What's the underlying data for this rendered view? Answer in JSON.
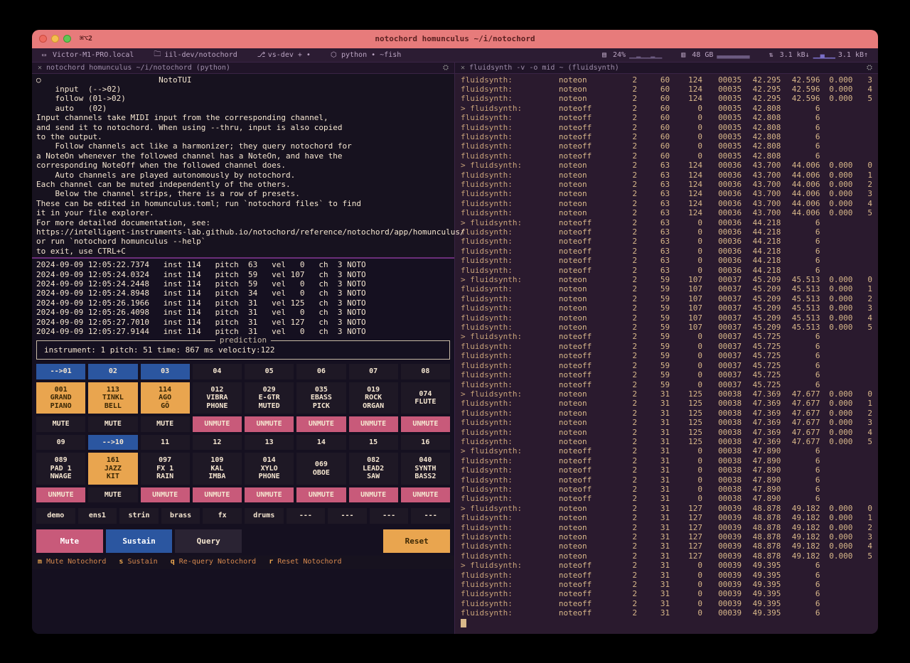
{
  "titlebar": {
    "shortcut": "⌘⌥2",
    "title": "notochord homunculus ~/i/notochord"
  },
  "tabbar": {
    "host": "Victor-M1-PRO.local",
    "folder": "iil-dev/notochord",
    "branch": "vs-dev + •",
    "lang": "python • ~fish",
    "cpu": "24%",
    "mem": "48 GB",
    "net_down": "3.1 kB↓",
    "net_up": "3.1 kB↑"
  },
  "leftTab": "notochord homunculus ~/i/notochord (python)",
  "rightTab": "fluidsynth -v -o mid ~ (fluidsynth)",
  "intro": "○                         NotoTUI\n    input  (-->02)\n    follow (01->02)\n    auto   (02)\nInput channels take MIDI input from the corresponding channel,\nand send it to notochord. When using --thru, input is also copied\nto the output.\n    Follow channels act like a harmonizer; they query notochord for\na NoteOn whenever the followed channel has a NoteOn, and have the\ncorresponding NoteOff when the followed channel does.\n    Auto channels are played autonomously by notochord.\nEach channel can be muted independently of the others.\n    Below the channel strips, there is a row of presets.\nThese can be edited in homunculus.toml; run `notochord files` to find\nit in your file explorer.\nFor more detailed documentation, see:\nhttps://intelligent-instruments-lab.github.io/notochord/reference/notochord/app/homunculus/\nor run `notochord homunculus --help`\nto exit, use CTRL+C",
  "events": "2024-09-09 12:05:22.7374   inst 114   pitch  63   vel   0   ch  3 NOTO\n2024-09-09 12:05:24.0324   inst 114   pitch  59   vel 107   ch  3 NOTO\n2024-09-09 12:05:24.2448   inst 114   pitch  59   vel   0   ch  3 NOTO\n2024-09-09 12:05:24.8948   inst 114   pitch  34   vel   0   ch  3 NOTO\n2024-09-09 12:05:26.1966   inst 114   pitch  31   vel 125   ch  3 NOTO\n2024-09-09 12:05:26.4098   inst 114   pitch  31   vel   0   ch  3 NOTO\n2024-09-09 12:05:27.7010   inst 114   pitch  31   vel 127   ch  3 NOTO\n2024-09-09 12:05:27.9144   inst 114   pitch  31   vel   0   ch  3 NOTO",
  "prediction": {
    "legend": "prediction",
    "text": "instrument:   1   pitch:  51   time:  867 ms   velocity:122"
  },
  "row1": [
    {
      "t": "-->01",
      "c": "blue"
    },
    {
      "t": "02",
      "c": "blue"
    },
    {
      "t": "03",
      "c": "blue"
    },
    {
      "t": "04",
      "c": "dark"
    },
    {
      "t": "05",
      "c": "dark"
    },
    {
      "t": "06",
      "c": "dark"
    },
    {
      "t": "07",
      "c": "dark"
    },
    {
      "t": "08",
      "c": "dark"
    }
  ],
  "row2": [
    {
      "t": "001\nGRAND\nPIANO",
      "c": "orange"
    },
    {
      "t": "113\nTINKL\nBELL",
      "c": "orange"
    },
    {
      "t": "114\nAGO\nGÔ",
      "c": "orange"
    },
    {
      "t": "012\nVIBRA\nPHONE",
      "c": "dark"
    },
    {
      "t": "029\nE-GTR\nMUTED",
      "c": "dark"
    },
    {
      "t": "035\nEBASS\nPICK",
      "c": "dark"
    },
    {
      "t": "019\nROCK\nORGAN",
      "c": "dark"
    },
    {
      "t": "074\nFLUTE\n",
      "c": "dark"
    }
  ],
  "row3": [
    {
      "t": "MUTE",
      "c": "dark"
    },
    {
      "t": "MUTE",
      "c": "dark"
    },
    {
      "t": "MUTE",
      "c": "dark"
    },
    {
      "t": "UNMUTE",
      "c": "pink"
    },
    {
      "t": "UNMUTE",
      "c": "pink"
    },
    {
      "t": "UNMUTE",
      "c": "pink"
    },
    {
      "t": "UNMUTE",
      "c": "pink"
    },
    {
      "t": "UNMUTE",
      "c": "pink"
    }
  ],
  "row4": [
    {
      "t": "09",
      "c": "dark"
    },
    {
      "t": "-->10",
      "c": "blue"
    },
    {
      "t": "11",
      "c": "dark"
    },
    {
      "t": "12",
      "c": "dark"
    },
    {
      "t": "13",
      "c": "dark"
    },
    {
      "t": "14",
      "c": "dark"
    },
    {
      "t": "15",
      "c": "dark"
    },
    {
      "t": "16",
      "c": "dark"
    }
  ],
  "row5": [
    {
      "t": "089\nPAD 1\nNWAGE",
      "c": "dark"
    },
    {
      "t": "161\nJAZZ\nKIT",
      "c": "orange"
    },
    {
      "t": "097\nFX  1\nRAIN",
      "c": "dark"
    },
    {
      "t": "109\nKAL\nIMBA",
      "c": "dark"
    },
    {
      "t": "014\nXYLO\nPHONE",
      "c": "dark"
    },
    {
      "t": "069\nOBOE\n",
      "c": "dark"
    },
    {
      "t": "082\nLEAD2\nSAW",
      "c": "dark"
    },
    {
      "t": "040\nSYNTH\nBASS2",
      "c": "dark"
    }
  ],
  "row6": [
    {
      "t": "UNMUTE",
      "c": "pink"
    },
    {
      "t": "MUTE",
      "c": "dark"
    },
    {
      "t": "UNMUTE",
      "c": "pink"
    },
    {
      "t": "UNMUTE",
      "c": "pink"
    },
    {
      "t": "UNMUTE",
      "c": "pink"
    },
    {
      "t": "UNMUTE",
      "c": "pink"
    },
    {
      "t": "UNMUTE",
      "c": "pink"
    },
    {
      "t": "UNMUTE",
      "c": "pink"
    }
  ],
  "presets": [
    "demo",
    "ens1",
    "strin",
    "brass",
    "fx",
    "drums",
    "---",
    "---",
    "---",
    "---"
  ],
  "actions": {
    "mute": "Mute",
    "sustain": "Sustain",
    "query": "Query",
    "reset": "Reset"
  },
  "hints": {
    "m": "m",
    "m_t": "Mute Notochord",
    "s": "s",
    "s_t": "Sustain",
    "q": "q",
    "q_t": "Re-query Notochord",
    "r": "r",
    "r_t": "Reset Notochord"
  },
  "log": [
    [
      "fluidsynth:",
      "noteon",
      "2",
      "60",
      "124",
      "00035",
      "42.295",
      "42.596",
      "0.000",
      "3"
    ],
    [
      "fluidsynth:",
      "noteon",
      "2",
      "60",
      "124",
      "00035",
      "42.295",
      "42.596",
      "0.000",
      "4"
    ],
    [
      "fluidsynth:",
      "noteon",
      "2",
      "60",
      "124",
      "00035",
      "42.295",
      "42.596",
      "0.000",
      "5"
    ],
    [
      "> fluidsynth:",
      "noteoff",
      "2",
      "60",
      "0",
      "00035",
      "42.808",
      "6",
      "",
      ""
    ],
    [
      "fluidsynth:",
      "noteoff",
      "2",
      "60",
      "0",
      "00035",
      "42.808",
      "6",
      "",
      ""
    ],
    [
      "fluidsynth:",
      "noteoff",
      "2",
      "60",
      "0",
      "00035",
      "42.808",
      "6",
      "",
      ""
    ],
    [
      "fluidsynth:",
      "noteoff",
      "2",
      "60",
      "0",
      "00035",
      "42.808",
      "6",
      "",
      ""
    ],
    [
      "fluidsynth:",
      "noteoff",
      "2",
      "60",
      "0",
      "00035",
      "42.808",
      "6",
      "",
      ""
    ],
    [
      "fluidsynth:",
      "noteoff",
      "2",
      "60",
      "0",
      "00035",
      "42.808",
      "6",
      "",
      ""
    ],
    [
      "> fluidsynth:",
      "noteon",
      "2",
      "63",
      "124",
      "00036",
      "43.700",
      "44.006",
      "0.000",
      "0"
    ],
    [
      "fluidsynth:",
      "noteon",
      "2",
      "63",
      "124",
      "00036",
      "43.700",
      "44.006",
      "0.000",
      "1"
    ],
    [
      "fluidsynth:",
      "noteon",
      "2",
      "63",
      "124",
      "00036",
      "43.700",
      "44.006",
      "0.000",
      "2"
    ],
    [
      "fluidsynth:",
      "noteon",
      "2",
      "63",
      "124",
      "00036",
      "43.700",
      "44.006",
      "0.000",
      "3"
    ],
    [
      "fluidsynth:",
      "noteon",
      "2",
      "63",
      "124",
      "00036",
      "43.700",
      "44.006",
      "0.000",
      "4"
    ],
    [
      "fluidsynth:",
      "noteon",
      "2",
      "63",
      "124",
      "00036",
      "43.700",
      "44.006",
      "0.000",
      "5"
    ],
    [
      "> fluidsynth:",
      "noteoff",
      "2",
      "63",
      "0",
      "00036",
      "44.218",
      "6",
      "",
      ""
    ],
    [
      "fluidsynth:",
      "noteoff",
      "2",
      "63",
      "0",
      "00036",
      "44.218",
      "6",
      "",
      ""
    ],
    [
      "fluidsynth:",
      "noteoff",
      "2",
      "63",
      "0",
      "00036",
      "44.218",
      "6",
      "",
      ""
    ],
    [
      "fluidsynth:",
      "noteoff",
      "2",
      "63",
      "0",
      "00036",
      "44.218",
      "6",
      "",
      ""
    ],
    [
      "fluidsynth:",
      "noteoff",
      "2",
      "63",
      "0",
      "00036",
      "44.218",
      "6",
      "",
      ""
    ],
    [
      "fluidsynth:",
      "noteoff",
      "2",
      "63",
      "0",
      "00036",
      "44.218",
      "6",
      "",
      ""
    ],
    [
      "> fluidsynth:",
      "noteon",
      "2",
      "59",
      "107",
      "00037",
      "45.209",
      "45.513",
      "0.000",
      "0"
    ],
    [
      "fluidsynth:",
      "noteon",
      "2",
      "59",
      "107",
      "00037",
      "45.209",
      "45.513",
      "0.000",
      "1"
    ],
    [
      "fluidsynth:",
      "noteon",
      "2",
      "59",
      "107",
      "00037",
      "45.209",
      "45.513",
      "0.000",
      "2"
    ],
    [
      "fluidsynth:",
      "noteon",
      "2",
      "59",
      "107",
      "00037",
      "45.209",
      "45.513",
      "0.000",
      "3"
    ],
    [
      "fluidsynth:",
      "noteon",
      "2",
      "59",
      "107",
      "00037",
      "45.209",
      "45.513",
      "0.000",
      "4"
    ],
    [
      "fluidsynth:",
      "noteon",
      "2",
      "59",
      "107",
      "00037",
      "45.209",
      "45.513",
      "0.000",
      "5"
    ],
    [
      "> fluidsynth:",
      "noteoff",
      "2",
      "59",
      "0",
      "00037",
      "45.725",
      "6",
      "",
      ""
    ],
    [
      "fluidsynth:",
      "noteoff",
      "2",
      "59",
      "0",
      "00037",
      "45.725",
      "6",
      "",
      ""
    ],
    [
      "fluidsynth:",
      "noteoff",
      "2",
      "59",
      "0",
      "00037",
      "45.725",
      "6",
      "",
      ""
    ],
    [
      "fluidsynth:",
      "noteoff",
      "2",
      "59",
      "0",
      "00037",
      "45.725",
      "6",
      "",
      ""
    ],
    [
      "fluidsynth:",
      "noteoff",
      "2",
      "59",
      "0",
      "00037",
      "45.725",
      "6",
      "",
      ""
    ],
    [
      "fluidsynth:",
      "noteoff",
      "2",
      "59",
      "0",
      "00037",
      "45.725",
      "6",
      "",
      ""
    ],
    [
      "> fluidsynth:",
      "noteon",
      "2",
      "31",
      "125",
      "00038",
      "47.369",
      "47.677",
      "0.000",
      "0"
    ],
    [
      "fluidsynth:",
      "noteon",
      "2",
      "31",
      "125",
      "00038",
      "47.369",
      "47.677",
      "0.000",
      "1"
    ],
    [
      "fluidsynth:",
      "noteon",
      "2",
      "31",
      "125",
      "00038",
      "47.369",
      "47.677",
      "0.000",
      "2"
    ],
    [
      "fluidsynth:",
      "noteon",
      "2",
      "31",
      "125",
      "00038",
      "47.369",
      "47.677",
      "0.000",
      "3"
    ],
    [
      "fluidsynth:",
      "noteon",
      "2",
      "31",
      "125",
      "00038",
      "47.369",
      "47.677",
      "0.000",
      "4"
    ],
    [
      "fluidsynth:",
      "noteon",
      "2",
      "31",
      "125",
      "00038",
      "47.369",
      "47.677",
      "0.000",
      "5"
    ],
    [
      "> fluidsynth:",
      "noteoff",
      "2",
      "31",
      "0",
      "00038",
      "47.890",
      "6",
      "",
      ""
    ],
    [
      "fluidsynth:",
      "noteoff",
      "2",
      "31",
      "0",
      "00038",
      "47.890",
      "6",
      "",
      ""
    ],
    [
      "fluidsynth:",
      "noteoff",
      "2",
      "31",
      "0",
      "00038",
      "47.890",
      "6",
      "",
      ""
    ],
    [
      "fluidsynth:",
      "noteoff",
      "2",
      "31",
      "0",
      "00038",
      "47.890",
      "6",
      "",
      ""
    ],
    [
      "fluidsynth:",
      "noteoff",
      "2",
      "31",
      "0",
      "00038",
      "47.890",
      "6",
      "",
      ""
    ],
    [
      "fluidsynth:",
      "noteoff",
      "2",
      "31",
      "0",
      "00038",
      "47.890",
      "6",
      "",
      ""
    ],
    [
      "> fluidsynth:",
      "noteon",
      "2",
      "31",
      "127",
      "00039",
      "48.878",
      "49.182",
      "0.000",
      "0"
    ],
    [
      "fluidsynth:",
      "noteon",
      "2",
      "31",
      "127",
      "00039",
      "48.878",
      "49.182",
      "0.000",
      "1"
    ],
    [
      "fluidsynth:",
      "noteon",
      "2",
      "31",
      "127",
      "00039",
      "48.878",
      "49.182",
      "0.000",
      "2"
    ],
    [
      "fluidsynth:",
      "noteon",
      "2",
      "31",
      "127",
      "00039",
      "48.878",
      "49.182",
      "0.000",
      "3"
    ],
    [
      "fluidsynth:",
      "noteon",
      "2",
      "31",
      "127",
      "00039",
      "48.878",
      "49.182",
      "0.000",
      "4"
    ],
    [
      "fluidsynth:",
      "noteon",
      "2",
      "31",
      "127",
      "00039",
      "48.878",
      "49.182",
      "0.000",
      "5"
    ],
    [
      "> fluidsynth:",
      "noteoff",
      "2",
      "31",
      "0",
      "00039",
      "49.395",
      "6",
      "",
      ""
    ],
    [
      "fluidsynth:",
      "noteoff",
      "2",
      "31",
      "0",
      "00039",
      "49.395",
      "6",
      "",
      ""
    ],
    [
      "fluidsynth:",
      "noteoff",
      "2",
      "31",
      "0",
      "00039",
      "49.395",
      "6",
      "",
      ""
    ],
    [
      "fluidsynth:",
      "noteoff",
      "2",
      "31",
      "0",
      "00039",
      "49.395",
      "6",
      "",
      ""
    ],
    [
      "fluidsynth:",
      "noteoff",
      "2",
      "31",
      "0",
      "00039",
      "49.395",
      "6",
      "",
      ""
    ],
    [
      "fluidsynth:",
      "noteoff",
      "2",
      "31",
      "0",
      "00039",
      "49.395",
      "6",
      "",
      ""
    ]
  ]
}
